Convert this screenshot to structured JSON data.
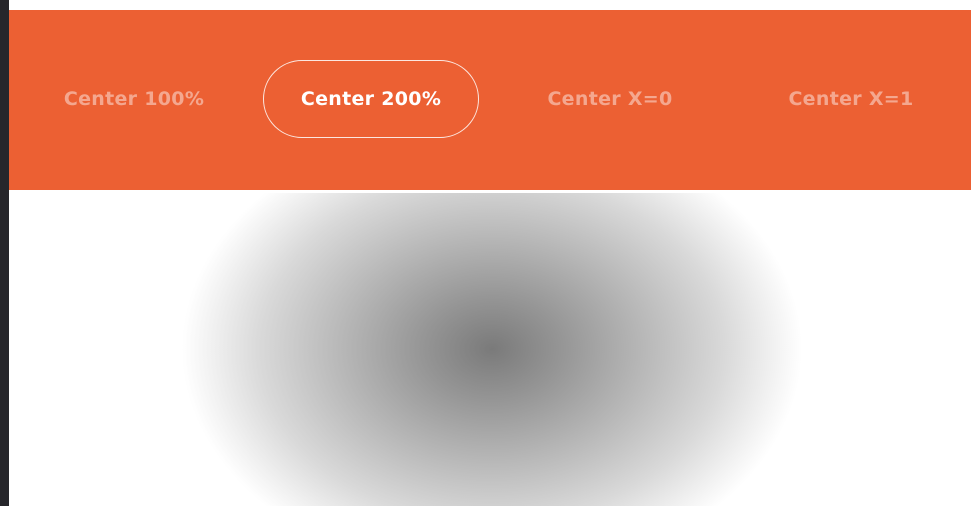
{
  "tabs": [
    {
      "label": "Center 100%",
      "active": false
    },
    {
      "label": "Center 200%",
      "active": true
    },
    {
      "label": "Center X=0",
      "active": false
    },
    {
      "label": "Center X=1",
      "active": false
    }
  ],
  "colors": {
    "accent": "#ec6033",
    "tab_text_inactive": "#f6b09a",
    "tab_text_active": "#ffffff",
    "gradient_center": "#7a7a7a",
    "gradient_edge": "#ffffff"
  },
  "preview": {
    "gradient_type": "radial"
  }
}
